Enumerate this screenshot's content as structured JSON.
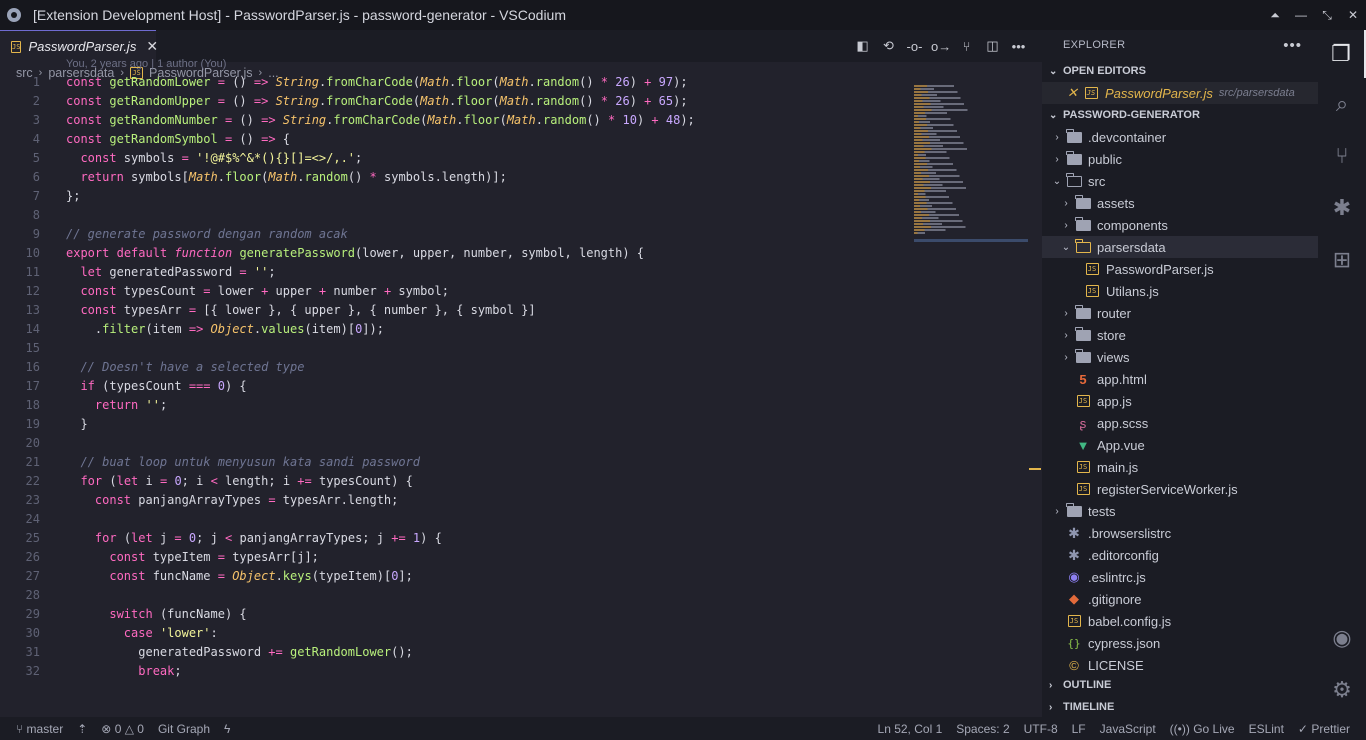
{
  "window": {
    "title": "[Extension Development Host] - PasswordParser.js - password-generator - VSCodium"
  },
  "tab": {
    "label": "PasswordParser.js",
    "badge": "JS"
  },
  "breadcrumb": {
    "part1": "src",
    "part2": "parsersdata",
    "part3": "PasswordParser.js",
    "part4": "..."
  },
  "blame": "You, 2 years ago | 1 author (You)",
  "code_lines": [
    "const getRandomLower = () => String.fromCharCode(Math.floor(Math.random() * 26) + 97);",
    "const getRandomUpper = () => String.fromCharCode(Math.floor(Math.random() * 26) + 65);",
    "const getRandomNumber = () => String.fromCharCode(Math.floor(Math.random() * 10) + 48);",
    "const getRandomSymbol = () => {",
    "  const symbols = '!@#$%^&*(){}[]=<>/,.';",
    "  return symbols[Math.floor(Math.random() * symbols.length)];",
    "};",
    "",
    "// generate password dengan random acak",
    "export default function generatePassword(lower, upper, number, symbol, length) {",
    "  let generatedPassword = '';",
    "  const typesCount = lower + upper + number + symbol;",
    "  const typesArr = [{ lower }, { upper }, { number }, { symbol }]",
    "    .filter(item => Object.values(item)[0]);",
    "",
    "  // Doesn't have a selected type",
    "  if (typesCount === 0) {",
    "    return '';",
    "  }",
    "",
    "  // buat loop untuk menyusun kata sandi password",
    "  for (let i = 0; i < length; i += typesCount) {",
    "    const panjangArrayTypes = typesArr.length;",
    "",
    "    for (let j = 0; j < panjangArrayTypes; j += 1) {",
    "      const typeItem = typesArr[j];",
    "      const funcName = Object.keys(typeItem)[0];",
    "",
    "      switch (funcName) {",
    "        case 'lower':",
    "          generatedPassword += getRandomLower();",
    "          break;"
  ],
  "sidebar": {
    "header": "EXPLORER",
    "open_editors_label": "OPEN EDITORS",
    "open_editor": {
      "name": "PasswordParser.js",
      "path": "src/parsersdata"
    },
    "project_label": "PASSWORD-GENERATOR",
    "tree": [
      {
        "name": ".devcontainer",
        "kind": "folder"
      },
      {
        "name": "public",
        "kind": "folder"
      },
      {
        "name": "src",
        "kind": "folder-open"
      },
      {
        "name": "assets",
        "kind": "folder"
      },
      {
        "name": "components",
        "kind": "folder"
      },
      {
        "name": "parsersdata",
        "kind": "folder-open"
      },
      {
        "name": "PasswordParser.js",
        "kind": "js"
      },
      {
        "name": "Utilans.js",
        "kind": "js"
      },
      {
        "name": "router",
        "kind": "folder"
      },
      {
        "name": "store",
        "kind": "folder"
      },
      {
        "name": "views",
        "kind": "folder"
      },
      {
        "name": "app.html",
        "kind": "html"
      },
      {
        "name": "app.js",
        "kind": "js"
      },
      {
        "name": "app.scss",
        "kind": "scss"
      },
      {
        "name": "App.vue",
        "kind": "vue"
      },
      {
        "name": "main.js",
        "kind": "js"
      },
      {
        "name": "registerServiceWorker.js",
        "kind": "js"
      },
      {
        "name": "tests",
        "kind": "folder"
      },
      {
        "name": ".browserslistrc",
        "kind": "config"
      },
      {
        "name": ".editorconfig",
        "kind": "config"
      },
      {
        "name": ".eslintrc.js",
        "kind": "eslint"
      },
      {
        "name": ".gitignore",
        "kind": "git"
      },
      {
        "name": "babel.config.js",
        "kind": "js"
      },
      {
        "name": "cypress.json",
        "kind": "json"
      },
      {
        "name": "LICENSE",
        "kind": "license"
      }
    ],
    "outline_label": "OUTLINE",
    "timeline_label": "TIMELINE"
  },
  "statusbar": {
    "branch": "master",
    "errors": "0",
    "warnings": "0",
    "git_graph": "Git Graph",
    "position": "Ln 52, Col 1",
    "spaces": "Spaces: 2",
    "encoding": "UTF-8",
    "eol": "LF",
    "language": "JavaScript",
    "golive": "Go Live",
    "eslint": "ESLint",
    "prettier": "Prettier"
  }
}
